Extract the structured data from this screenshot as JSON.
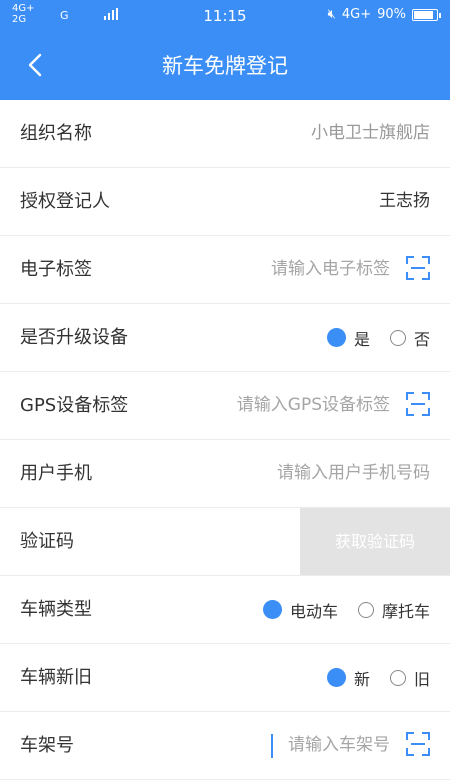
{
  "status_bar": {
    "network_left_top": "4G+",
    "network_left_bottom": "2G",
    "network_mid": "G",
    "time": "11:15",
    "network_right": "4G+",
    "battery": "90%",
    "battery_level": 0.9
  },
  "header": {
    "title": "新车免牌登记",
    "back_icon": "chevron-left-icon"
  },
  "form": {
    "org_name": {
      "label": "组织名称",
      "value": "小电卫士旗舰店"
    },
    "registrar": {
      "label": "授权登记人",
      "value": "王志扬"
    },
    "etag": {
      "label": "电子标签",
      "placeholder": "请输入电子标签"
    },
    "upgrade_device": {
      "label": "是否升级设备",
      "options": [
        "是",
        "否"
      ],
      "selected": "是"
    },
    "gps_tag": {
      "label": "GPS设备标签",
      "placeholder": "请输入GPS设备标签"
    },
    "phone": {
      "label": "用户手机",
      "placeholder": "请输入用户手机号码"
    },
    "verify_code": {
      "label": "验证码",
      "button": "获取验证码"
    },
    "vehicle_type": {
      "label": "车辆类型",
      "options": [
        "电动车",
        "摩托车"
      ],
      "selected": "电动车"
    },
    "vehicle_condition": {
      "label": "车辆新旧",
      "options": [
        "新",
        "旧"
      ],
      "selected": "新"
    },
    "frame_no": {
      "label": "车架号",
      "placeholder": "请输入车架号"
    }
  },
  "colors": {
    "accent": "#3a8ef6",
    "divider": "#ececec",
    "button_disabled": "#e3e3e3"
  }
}
